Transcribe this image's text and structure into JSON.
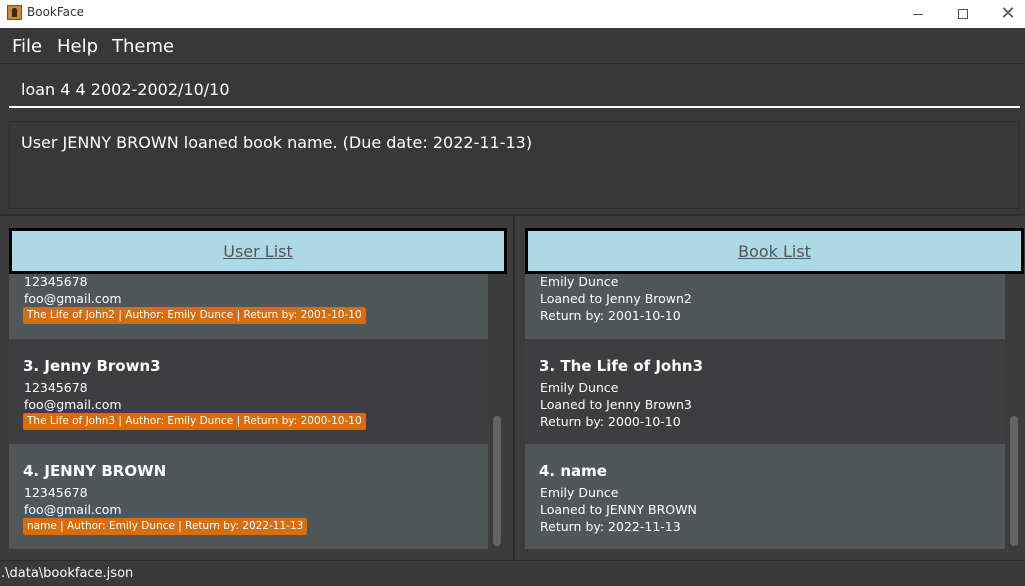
{
  "window": {
    "title": "BookFace",
    "icon": "bookface-app-icon"
  },
  "menu": {
    "items": [
      "File",
      "Help",
      "Theme"
    ]
  },
  "command": {
    "value": "loan 4 4 2002-2002/10/10"
  },
  "result": {
    "text": "User JENNY BROWN loaned book name. (Due date: 2022-11-13)"
  },
  "user_list": {
    "header": "User List",
    "cards": [
      {
        "phone": "12345678",
        "email": "foo@gmail.com",
        "tag": "The Life of John2 | Author: Emily Dunce | Return by: 2001-10-10"
      },
      {
        "title": "3.  Jenny Brown3",
        "phone": "12345678",
        "email": "foo@gmail.com",
        "tag": "The Life of John3 | Author: Emily Dunce | Return by: 2000-10-10"
      },
      {
        "title": "4.  JENNY BROWN",
        "phone": "12345678",
        "email": "foo@gmail.com",
        "tag": "name | Author: Emily Dunce | Return by: 2022-11-13"
      }
    ]
  },
  "book_list": {
    "header": "Book List",
    "cards": [
      {
        "author": "Emily Dunce",
        "loaned": "Loaned to Jenny Brown2",
        "return": "Return by: 2001-10-10"
      },
      {
        "title": "3.  The Life of John3",
        "author": "Emily Dunce",
        "loaned": "Loaned to Jenny Brown3",
        "return": "Return by: 2000-10-10"
      },
      {
        "title": "4.  name",
        "author": "Emily Dunce",
        "loaned": "Loaned to JENNY BROWN",
        "return": "Return by: 2022-11-13"
      }
    ]
  },
  "status": {
    "path": ".\\data\\bookface.json"
  },
  "colors": {
    "header_bg": "#add8e6",
    "tag_bg": "#d86d0b",
    "card_dark": "#3e3e41",
    "card_light": "#515658",
    "background": "#383838"
  }
}
